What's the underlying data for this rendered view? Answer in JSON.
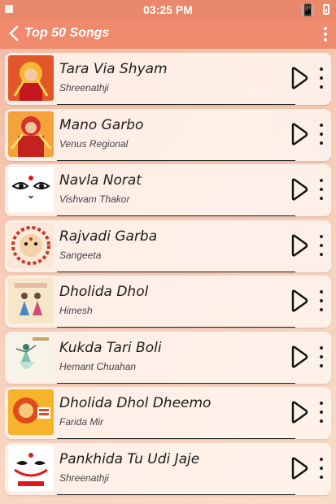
{
  "status_bar": {
    "time": "03:25 PM"
  },
  "app_bar": {
    "title": "Top 50 Songs"
  },
  "colors": {
    "accent": "#f08a6c",
    "status": "#e9886a"
  },
  "songs": [
    {
      "title": "Tara Via Shyam",
      "artist": "Shreenathji",
      "thumb": "deity-red"
    },
    {
      "title": "Mano Garbo",
      "artist": "Venus Regional",
      "thumb": "deity-orange"
    },
    {
      "title": "Navla Norat",
      "artist": "Vishvam Thakor",
      "thumb": "eyes-face"
    },
    {
      "title": "Rajvadi Garba",
      "artist": "Sangeeta",
      "thumb": "ornate-face"
    },
    {
      "title": "Dholida Dhol",
      "artist": "Himesh",
      "thumb": "dancers"
    },
    {
      "title": "Kukda Tari Boli",
      "artist": "Hemant Chuahan",
      "thumb": "dancer-sketch"
    },
    {
      "title": "Dholida Dhol Dheemo",
      "artist": "Farida Mir",
      "thumb": "festive-yellow"
    },
    {
      "title": "Pankhida Tu Udi Jaje",
      "artist": "Shreenathji",
      "thumb": "navratri-face"
    }
  ]
}
